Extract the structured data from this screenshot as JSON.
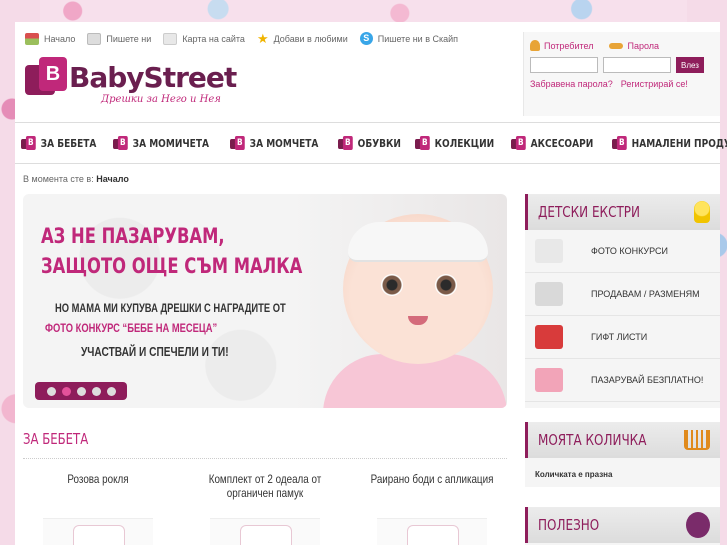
{
  "toplinks": [
    {
      "label": "Начало",
      "icon": "home-icon"
    },
    {
      "label": "Пишете ни",
      "icon": "mail-icon"
    },
    {
      "label": "Карта на сайта",
      "icon": "sitemap-icon"
    },
    {
      "label": "Добави в любими",
      "icon": "star-icon"
    },
    {
      "label": "Пишете ни в Скайп",
      "icon": "skype-icon"
    }
  ],
  "logo": {
    "text": "BabyStreet",
    "tagline": "Дрешки за Него и Нея"
  },
  "login": {
    "user_label": "Потребител",
    "pass_label": "Парола",
    "button": "Влез",
    "forgot": "Забравена парола?",
    "register": "Регистрирай се!"
  },
  "nav": [
    "ЗА БЕБЕТА",
    "ЗА МОМИЧЕТА",
    "ЗА МОМЧЕТА",
    "ОБУВКИ",
    "КОЛЕКЦИИ",
    "АКСЕСОАРИ",
    "НАМАЛЕНИ ПРОДУКТИ"
  ],
  "breadcrumb": {
    "prefix": "В момента сте в:",
    "current": "Начало"
  },
  "banner": {
    "line1": "АЗ НЕ ПАЗАРУВАМ,",
    "line2": "ЗАЩОТО ОЩЕ СЪМ МАЛКА",
    "line3": "НО МАМА МИ КУПУВА ДРЕШКИ С НАГРАДИТЕ ОТ",
    "line4_pre": "ФОТО КОНКУРС",
    "line4_hl": "“БЕБЕ НА МЕСЕЦА”",
    "line5": "УЧАСТВАЙ И СПЕЧЕЛИ И ТИ!",
    "slides": 5,
    "active_slide": 2
  },
  "extras": {
    "title": "ДЕТСКИ ЕКСТРИ",
    "items": [
      {
        "label": "ФОТО КОНКУРСИ",
        "icon": "camera-icon",
        "color": "#e8e8e8"
      },
      {
        "label": "ПРОДАВАМ / РАЗМЕНЯМ",
        "icon": "megaphone-icon",
        "color": "#d9d9d9"
      },
      {
        "label": "ГИФТ ЛИСТИ",
        "icon": "gift-icon",
        "color": "#d83b3b"
      },
      {
        "label": "ПАЗАРУВАЙ БЕЗПЛАТНО!",
        "icon": "piggy-bank-icon",
        "color": "#f2a4b8"
      }
    ]
  },
  "cart": {
    "title": "МОЯТА КОЛИЧКА",
    "empty": "Количката е празна"
  },
  "useful": {
    "title": "ПОЛЕЗНО"
  },
  "section": {
    "title": "ЗА БЕБЕТА"
  },
  "products": [
    {
      "name": "Розова рокля"
    },
    {
      "name": "Комплект от 2 одеала от органичен памук"
    },
    {
      "name": "Раирано боди с апликация"
    }
  ],
  "colors": {
    "brand": "#8e1d5b",
    "accent": "#c0287a"
  }
}
